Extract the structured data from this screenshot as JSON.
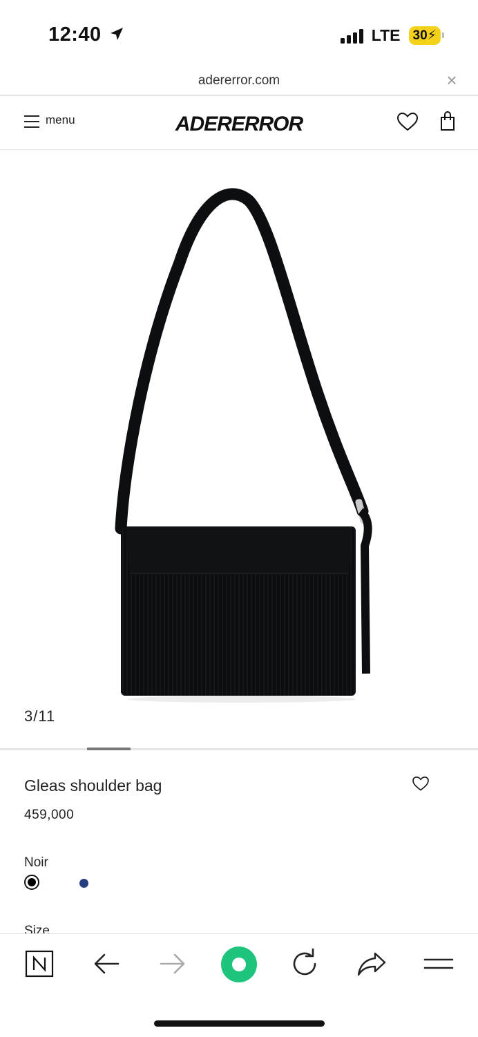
{
  "status_bar": {
    "time": "12:40",
    "network": "LTE",
    "battery": "30"
  },
  "browser": {
    "url": "adererror.com",
    "close_icon": "close-icon"
  },
  "site_header": {
    "menu_label": "menu",
    "logo": "ADERERROR",
    "icons": [
      "menu-icon",
      "heart-icon",
      "shopping-bag-icon"
    ]
  },
  "gallery": {
    "counter": "3/11",
    "position_fraction": 0.27
  },
  "product": {
    "name": "Gleas shoulder bag",
    "price": "459,000",
    "color_label": "Noir",
    "colors": [
      {
        "name": "Noir",
        "hex": "#000000",
        "selected": true
      },
      {
        "name": "Navy",
        "hex": "#263d82",
        "selected": false
      }
    ],
    "size_label": "Size"
  },
  "toolbar": {
    "icons": [
      "naver-icon",
      "back-arrow-icon",
      "forward-arrow-icon",
      "green-dot-icon",
      "reload-icon",
      "share-icon",
      "hamburger-menu-icon"
    ],
    "accent": "#1ec47b"
  }
}
